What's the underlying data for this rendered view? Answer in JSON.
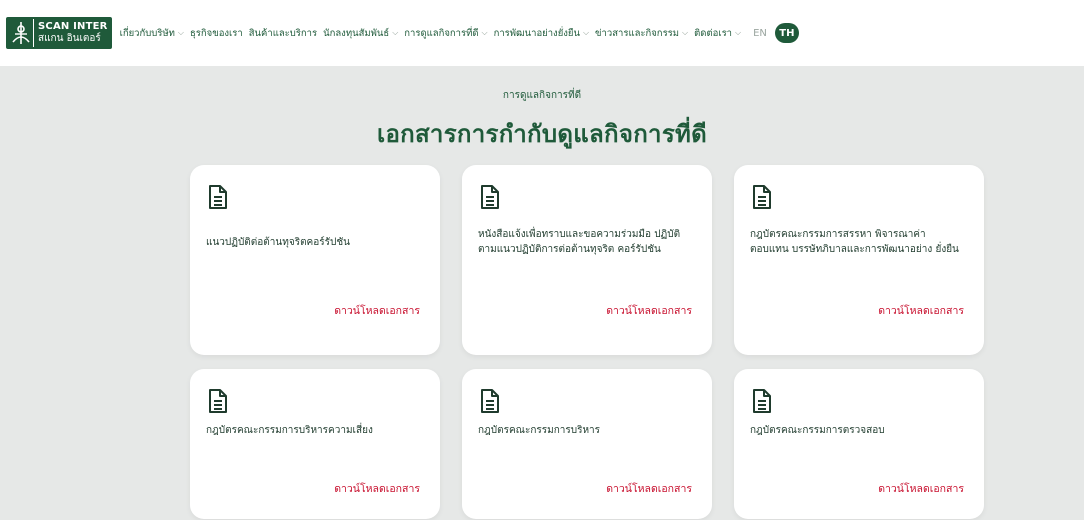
{
  "logo": {
    "en": "SCAN INTER",
    "th": "สแกน อินเตอร์"
  },
  "nav": [
    {
      "label": "เกี่ยวกับบริษัท",
      "dropdown": true
    },
    {
      "label": "ธุรกิจของเรา",
      "dropdown": false
    },
    {
      "label": "สินค้าและบริการ",
      "dropdown": false
    },
    {
      "label": "นักลงทุนสัมพันธ์",
      "dropdown": true
    },
    {
      "label": "การดูแลกิจการที่ดี",
      "dropdown": true
    },
    {
      "label": "การพัฒนาอย่างยั่งยืน",
      "dropdown": true
    },
    {
      "label": "ข่าวสารและกิจกรรม",
      "dropdown": true
    },
    {
      "label": "ติดต่อเรา",
      "dropdown": true
    }
  ],
  "lang": {
    "en": "EN",
    "th": "TH"
  },
  "breadcrumb": "การดูแลกิจการที่ดี",
  "page_title": "เอกสารการกำกับดูแลกิจการที่ดี",
  "download_label": "ดาวน์โหลดเอกสาร",
  "cards": [
    {
      "title": "แนวปฏิบัติต่อต้านทุจริตคอร์รัปชัน"
    },
    {
      "title": "หนังสือแจ้งเพื่อทราบและขอความร่วมมือ ปฏิบัติตามแนวปฏิบัติการต่อต้านทุจริต คอร์รัปชัน"
    },
    {
      "title": "กฎบัตรคณะกรรมการสรรหา พิจารณาค่า ตอบแทน บรรษัทภิบาลและการพัฒนาอย่าง ยั่งยืน"
    },
    {
      "title": "กฎบัตรคณะกรรมการบริหารความเสี่ยง"
    },
    {
      "title": "กฎบัตรคณะกรรมการบริหาร"
    },
    {
      "title": "กฎบัตรคณะกรรมการตรวจสอบ"
    }
  ],
  "colors": {
    "brand": "#1f5a3a",
    "accent": "#c8102e",
    "background": "#e6e8e7"
  }
}
